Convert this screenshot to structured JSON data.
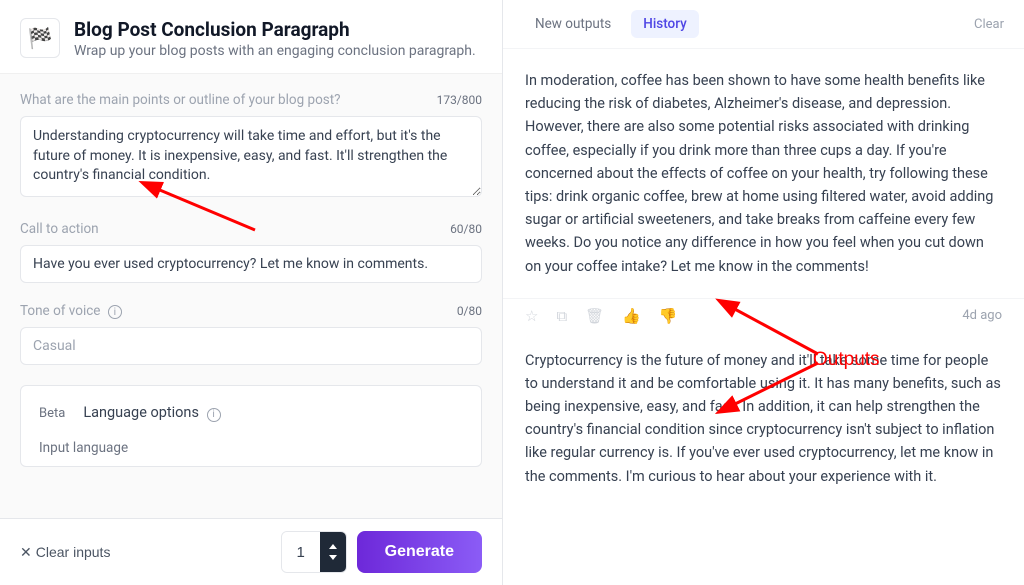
{
  "header": {
    "title": "Blog Post Conclusion Paragraph",
    "subtitle": "Wrap up your blog posts with an engaging conclusion paragraph.",
    "icon": "🏁"
  },
  "fields": {
    "mainPoints": {
      "label": "What are the main points or outline of your blog post?",
      "count": "173/800",
      "value": "Understanding cryptocurrency will take time and effort, but it's the future of money. It is inexpensive, easy, and fast. It'll strengthen the country's financial condition."
    },
    "cta": {
      "label": "Call to action",
      "count": "60/80",
      "value": "Have you ever used cryptocurrency? Let me know in comments."
    },
    "tone": {
      "label": "Tone of voice",
      "count": "0/80",
      "placeholder": "Casual"
    }
  },
  "langBox": {
    "beta": "Beta",
    "title": "Language options",
    "inputLangLabel": "Input language"
  },
  "footer": {
    "clear": "Clear inputs",
    "qty": "1",
    "generate": "Generate"
  },
  "rightTabs": {
    "new": "New outputs",
    "history": "History",
    "clear": "Clear"
  },
  "outputs": [
    {
      "text": "In moderation, coffee has been shown to have some health benefits like reducing the risk of diabetes, Alzheimer's disease, and depression. However, there are also some potential risks associated with drinking coffee, especially if you drink more than three cups a day. If you're concerned about the effects of coffee on your health, try following these tips: drink organic coffee, brew at home using filtered water, avoid adding sugar or artificial sweeteners, and take breaks from caffeine every few weeks. Do you notice any difference in how you feel when you cut down on your coffee intake? Let me know in the comments!"
    },
    {
      "text": "Cryptocurrency is the future of money and it'll take some time for people to understand it and be comfortable using it. It has many benefits, such as being inexpensive, easy, and fast. In addition, it can help strengthen the country's financial condition since cryptocurrency isn't subject to inflation like regular currency is. If you've ever used cryptocurrency, let me know in the comments. I'm curious to hear about your experience with it.",
      "ago": "4d ago"
    }
  ],
  "annotationLabel": "Outputs"
}
